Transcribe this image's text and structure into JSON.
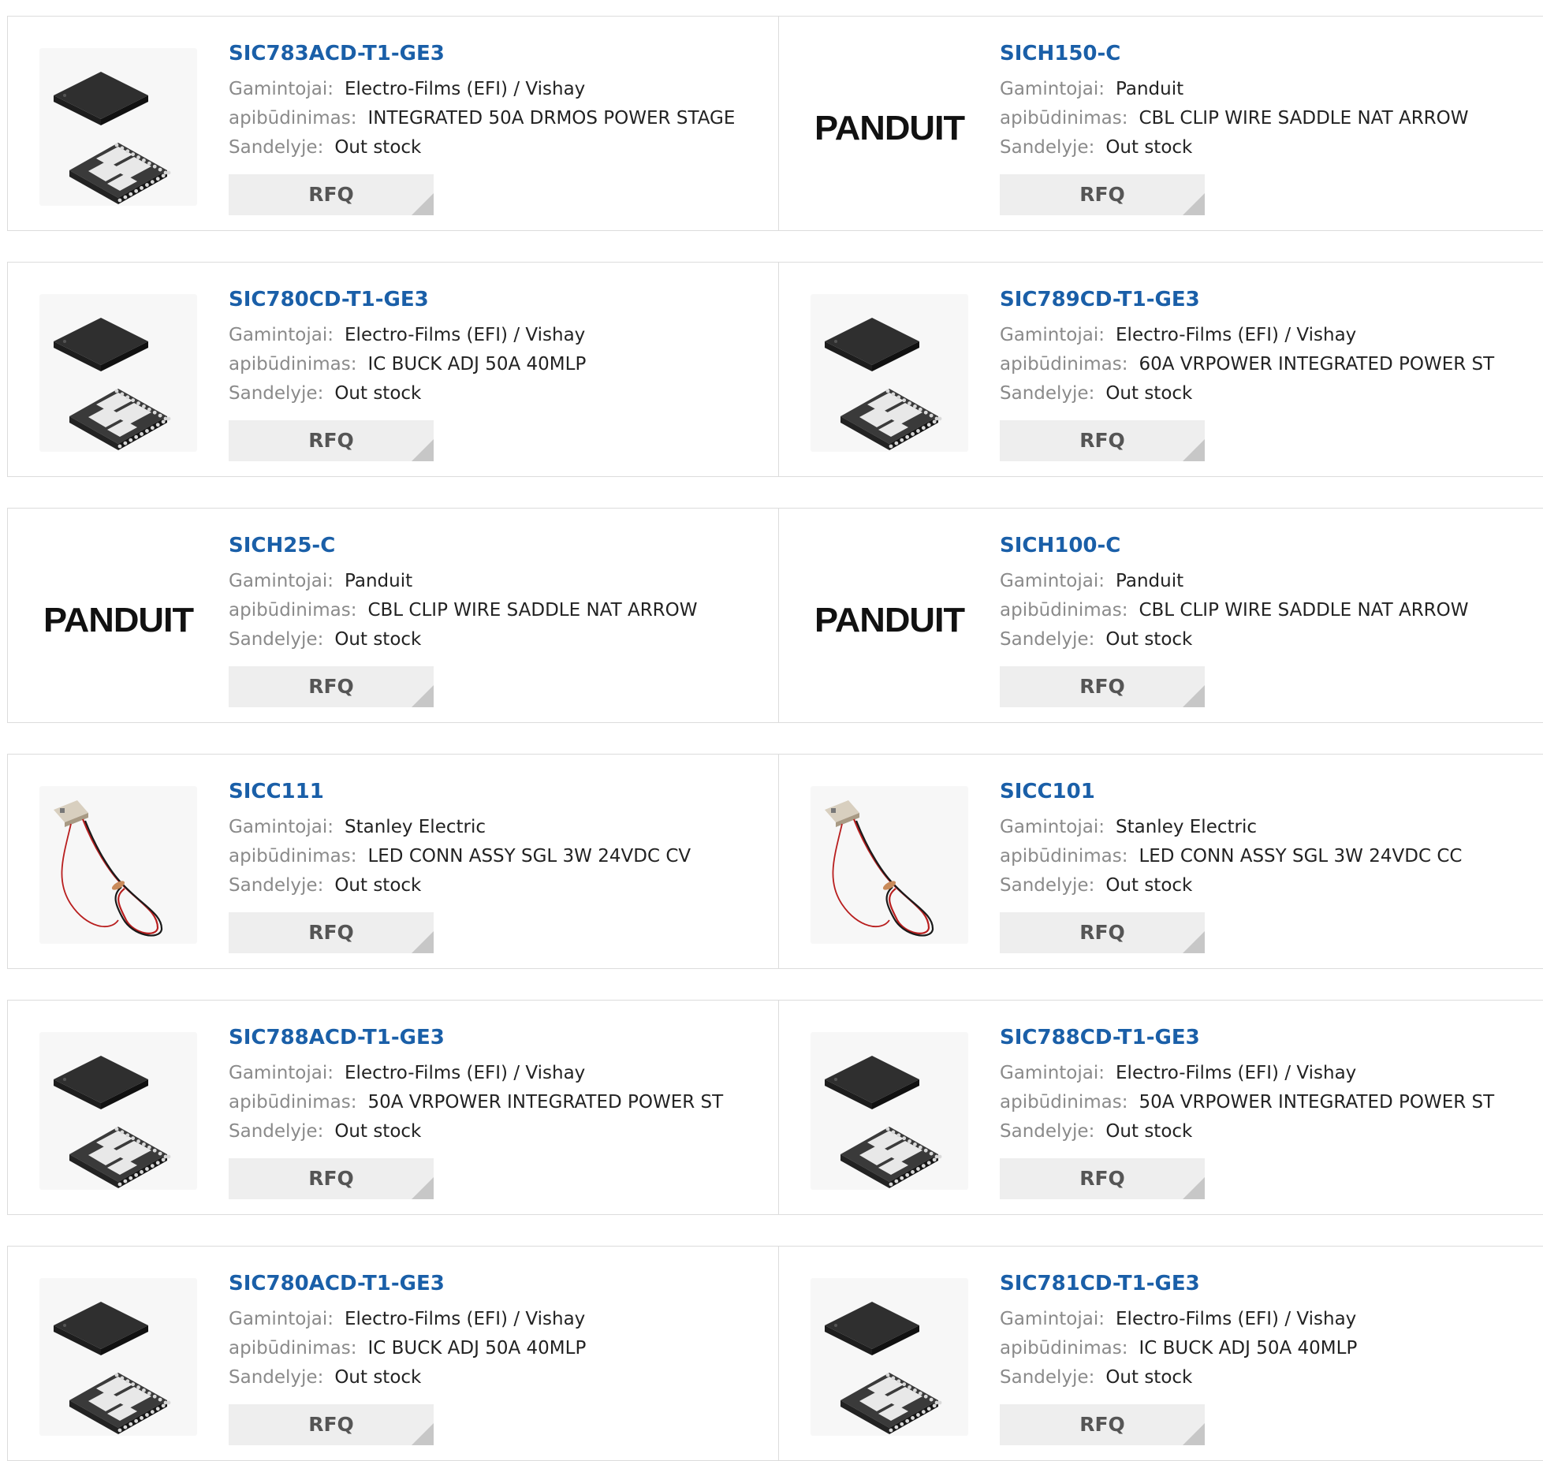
{
  "labels": {
    "manufacturer": "Gamintojai:",
    "description": "apibūdinimas:",
    "stock": "Sandelyje:",
    "rfq": "RFQ"
  },
  "products": [
    {
      "part": "SIC783ACD-T1-GE3",
      "manufacturer": "Electro-Films (EFI) / Vishay",
      "description": "INTEGRATED 50A DRMOS POWER STAGE",
      "stock": "Out stock",
      "image": "qfn-chip-icon"
    },
    {
      "part": "SICH150-C",
      "manufacturer": "Panduit",
      "description": "CBL CLIP WIRE SADDLE NAT ARROW",
      "stock": "Out stock",
      "image": "panduit-logo"
    },
    {
      "part": "SIC780CD-T1-GE3",
      "manufacturer": "Electro-Films (EFI) / Vishay",
      "description": "IC BUCK ADJ 50A 40MLP",
      "stock": "Out stock",
      "image": "qfn-chip-icon"
    },
    {
      "part": "SIC789CD-T1-GE3",
      "manufacturer": "Electro-Films (EFI) / Vishay",
      "description": "60A VRPOWER INTEGRATED POWER ST",
      "stock": "Out stock",
      "image": "qfn-chip-icon"
    },
    {
      "part": "SICH25-C",
      "manufacturer": "Panduit",
      "description": "CBL CLIP WIRE SADDLE NAT ARROW",
      "stock": "Out stock",
      "image": "panduit-logo"
    },
    {
      "part": "SICH100-C",
      "manufacturer": "Panduit",
      "description": "CBL CLIP WIRE SADDLE NAT ARROW",
      "stock": "Out stock",
      "image": "panduit-logo"
    },
    {
      "part": "SICC111",
      "manufacturer": "Stanley Electric",
      "description": "LED CONN ASSY SGL 3W 24VDC CV",
      "stock": "Out stock",
      "image": "led-cable-icon"
    },
    {
      "part": "SICC101",
      "manufacturer": "Stanley Electric",
      "description": "LED CONN ASSY SGL 3W 24VDC CC",
      "stock": "Out stock",
      "image": "led-cable-icon"
    },
    {
      "part": "SIC788ACD-T1-GE3",
      "manufacturer": "Electro-Films (EFI) / Vishay",
      "description": "50A VRPOWER INTEGRATED POWER ST",
      "stock": "Out stock",
      "image": "qfn-chip-icon"
    },
    {
      "part": "SIC788CD-T1-GE3",
      "manufacturer": "Electro-Films (EFI) / Vishay",
      "description": "50A VRPOWER INTEGRATED POWER ST",
      "stock": "Out stock",
      "image": "qfn-chip-icon"
    },
    {
      "part": "SIC780ACD-T1-GE3",
      "manufacturer": "Electro-Films (EFI) / Vishay",
      "description": "IC BUCK ADJ 50A 40MLP",
      "stock": "Out stock",
      "image": "qfn-chip-icon"
    },
    {
      "part": "SIC781CD-T1-GE3",
      "manufacturer": "Electro-Films (EFI) / Vishay",
      "description": "IC BUCK ADJ 50A 40MLP",
      "stock": "Out stock",
      "image": "qfn-chip-icon"
    }
  ],
  "logo_text": "PANDUIT",
  "colors": {
    "link": "#1a5fa8",
    "label": "#8a8a8a",
    "value": "#222222",
    "button_bg": "#eeeeee"
  }
}
